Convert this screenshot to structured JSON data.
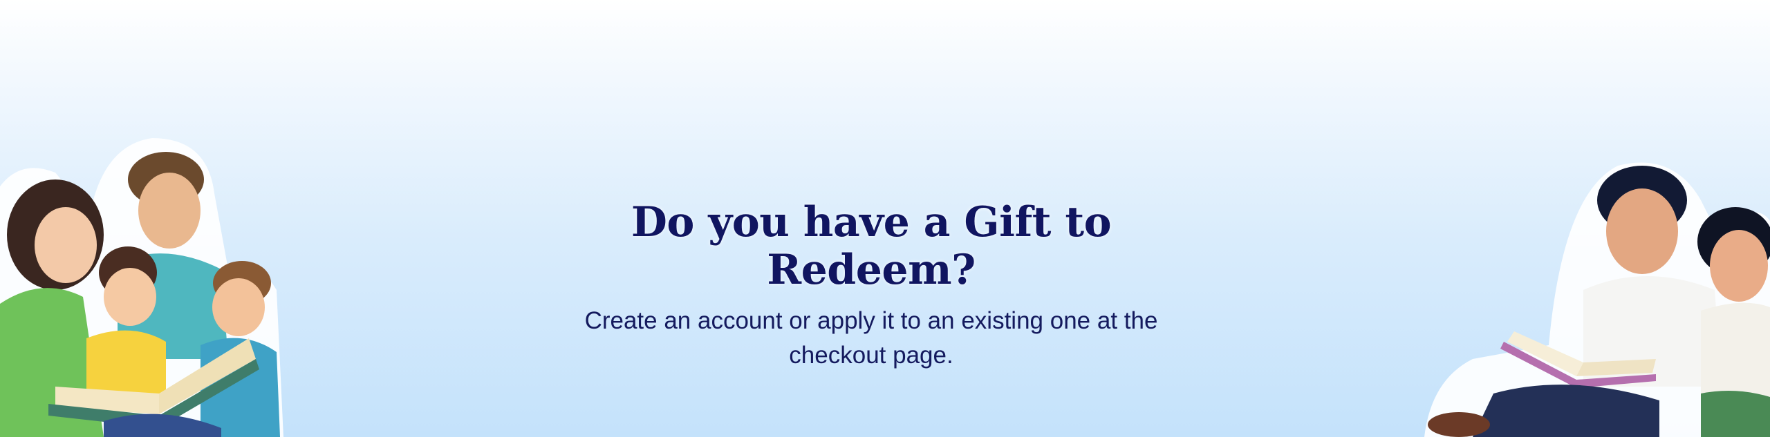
{
  "banner": {
    "title": "Do you have a Gift to Redeem?",
    "subtitle": "Create an account or apply it to an existing one at the checkout page."
  },
  "illustrations": {
    "left": "family-reading-illustration",
    "right": "children-reading-illustration"
  },
  "colors": {
    "title": "#101560",
    "subtitle": "#141a5e",
    "background_top": "#ffffff",
    "background_bottom": "#c4e2fb"
  }
}
